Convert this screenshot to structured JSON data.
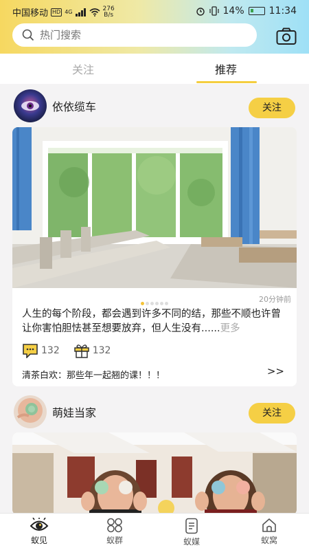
{
  "status_bar": {
    "carrier": "中国移动",
    "hd": "HD",
    "net": "4G",
    "speed": "276",
    "speed_unit": "B/s",
    "battery": "14%",
    "time": "11:34"
  },
  "search": {
    "placeholder": "热门搜索"
  },
  "tabs": [
    {
      "label": "关注",
      "active": false
    },
    {
      "label": "推荐",
      "active": true
    }
  ],
  "accent_color": "#f5cf45",
  "posts": [
    {
      "author": "依依缆车",
      "follow_label": "关注",
      "time": "20分钟前",
      "excerpt": "人生的每个阶段，都会遇到许多不同的结，那些不顺也许曾让你害怕胆怯甚至想要放弃，但人生没有......",
      "more_label": "更多",
      "comments": "132",
      "gifts": "132",
      "top_comment": "清茶白欢：那些年一起翘的课！！！",
      "more_arrow": ">>",
      "carousel": {
        "count": 6,
        "active_index": 0
      }
    },
    {
      "author": "萌娃当家",
      "follow_label": "关注"
    }
  ],
  "nav": [
    {
      "label": "蚁见",
      "icon": "eye-icon",
      "active": true
    },
    {
      "label": "蚁群",
      "icon": "grid-icon",
      "active": false
    },
    {
      "label": "蚁媒",
      "icon": "document-icon",
      "active": false
    },
    {
      "label": "蚁窝",
      "icon": "home-icon",
      "active": false
    }
  ]
}
